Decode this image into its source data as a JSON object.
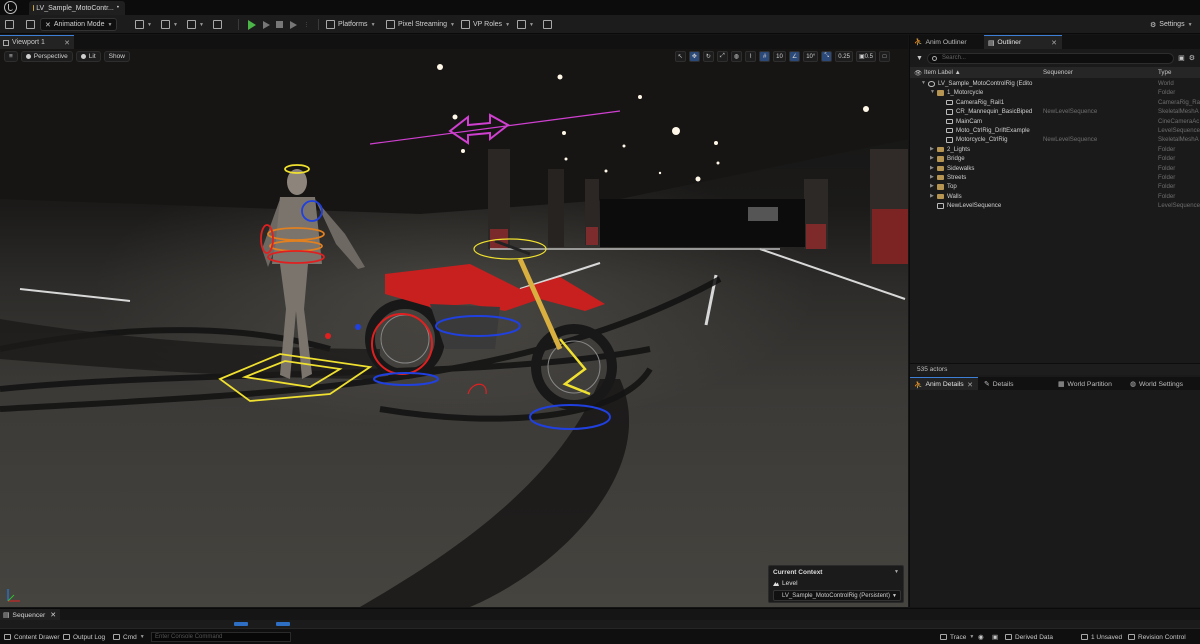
{
  "titlebar": {
    "level_tab": "LV_Sample_MotoContr...",
    "dirty_marker": "•"
  },
  "toolbar": {
    "mode": "Animation Mode",
    "platforms": "Platforms",
    "pixel_streaming": "Pixel Streaming",
    "vp_roles": "VP Roles",
    "settings": "Settings"
  },
  "viewport": {
    "tab_label": "Viewport 1",
    "perspective": "Perspective",
    "lit": "Lit",
    "show": "Show",
    "grid_snap": "10",
    "rotation_snap": "10°",
    "scale_snap": "0.25",
    "camera_speed": "0.5"
  },
  "current_context": {
    "title": "Current Context",
    "level_label": "Level",
    "level_value": "LV_Sample_MotoControlRig (Persistent)"
  },
  "right_panel": {
    "tabs": [
      "Anim Outliner",
      "Outliner"
    ],
    "search_placeholder": "Search...",
    "columns": {
      "item_label": "Item Label ▲",
      "sequencer": "Sequencer",
      "type": "Type"
    },
    "rows": [
      {
        "label": "LV_Sample_MotoControlRig (Edito",
        "sequencer": "",
        "type": "World",
        "indent": 0,
        "icon": "world",
        "expander": "open"
      },
      {
        "label": "1_Motorcycle",
        "sequencer": "",
        "type": "Folder",
        "indent": 1,
        "icon": "folder",
        "expander": "open"
      },
      {
        "label": "CameraRig_Rail1",
        "sequencer": "",
        "type": "CameraRig_Rai",
        "indent": 2,
        "icon": "actor",
        "expander": ""
      },
      {
        "label": "CR_Mannequin_BasicBiped",
        "sequencer": "NewLevelSequence",
        "type": "SkeletalMeshA",
        "indent": 2,
        "icon": "actor",
        "expander": ""
      },
      {
        "label": "MainCam",
        "sequencer": "",
        "type": "CineCameraAc",
        "indent": 2,
        "icon": "actor",
        "expander": ""
      },
      {
        "label": "Moto_CtrlRig_DriftExample",
        "sequencer": "",
        "type": "LevelSequence",
        "indent": 2,
        "icon": "actor",
        "expander": ""
      },
      {
        "label": "Motorcycle_CtrlRig",
        "sequencer": "NewLevelSequence",
        "type": "SkeletalMeshA",
        "indent": 2,
        "icon": "actor",
        "expander": ""
      },
      {
        "label": "2_Lights",
        "sequencer": "",
        "type": "Folder",
        "indent": 1,
        "icon": "folder",
        "expander": "closed"
      },
      {
        "label": "Bridge",
        "sequencer": "",
        "type": "Folder",
        "indent": 1,
        "icon": "folder",
        "expander": "closed"
      },
      {
        "label": "Sidewalks",
        "sequencer": "",
        "type": "Folder",
        "indent": 1,
        "icon": "folder",
        "expander": "closed"
      },
      {
        "label": "Streets",
        "sequencer": "",
        "type": "Folder",
        "indent": 1,
        "icon": "folder",
        "expander": "closed"
      },
      {
        "label": "Top",
        "sequencer": "",
        "type": "Folder",
        "indent": 1,
        "icon": "folder",
        "expander": "closed"
      },
      {
        "label": "Walls",
        "sequencer": "",
        "type": "Folder",
        "indent": 1,
        "icon": "folder",
        "expander": "closed"
      },
      {
        "label": "NewLevelSequence",
        "sequencer": "",
        "type": "LevelSequence",
        "indent": 1,
        "icon": "actor",
        "expander": ""
      }
    ],
    "actor_count": "535 actors",
    "detail_tabs": [
      "Anim Details",
      "Details",
      "World Partition",
      "World Settings"
    ]
  },
  "sequencer": {
    "tab_label": "Sequencer"
  },
  "statusbar": {
    "content_drawer": "Content Drawer",
    "output_log": "Output Log",
    "cmd": "Cmd",
    "cmd_placeholder": "Enter Console Command",
    "trace": "Trace",
    "derived_data": "Derived Data",
    "unsaved": "1 Unsaved",
    "revision_control": "Revision Control"
  },
  "colors": {
    "accent_blue": "#3d7fd6",
    "play_green": "#4cb547",
    "folder": "#b69552",
    "gizmo_yellow": "#f0e030",
    "gizmo_red": "#e02020",
    "gizmo_blue": "#2040e0",
    "gizmo_magenta": "#d040d0"
  }
}
